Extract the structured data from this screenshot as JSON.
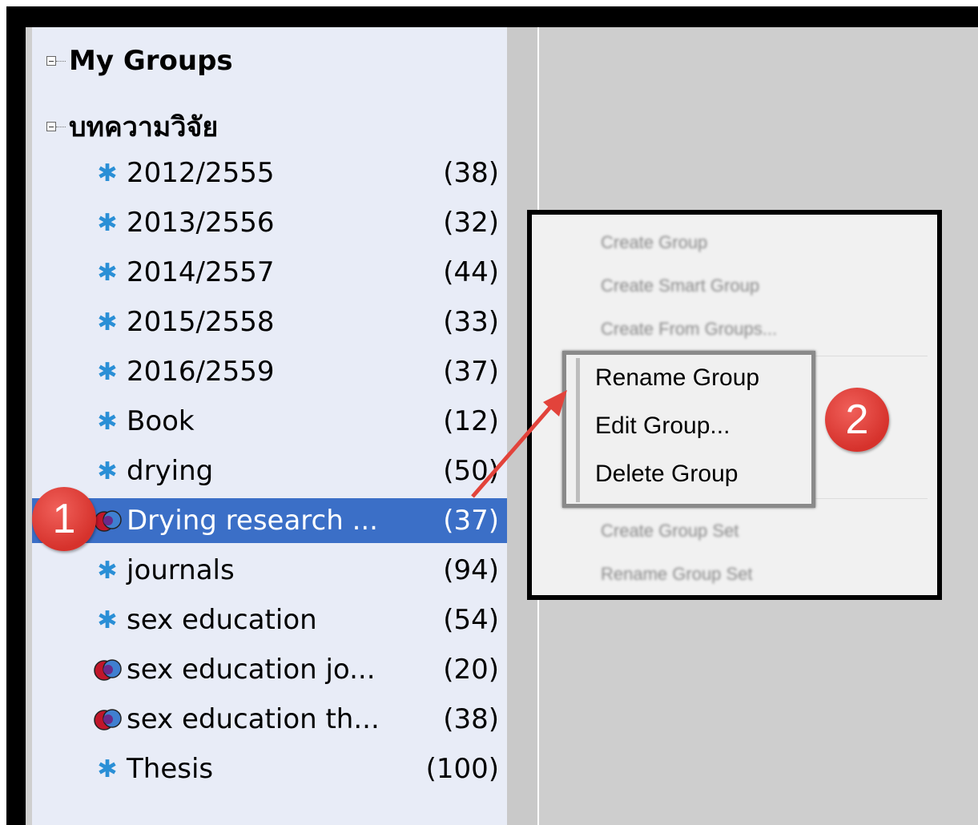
{
  "groups_header": "My Groups",
  "group_set_name": "บทความวิจัย",
  "groups": [
    {
      "label": "2012/2555",
      "count": "(38)",
      "kind": "group",
      "icon": "gear-icon"
    },
    {
      "label": "2013/2556",
      "count": "(32)",
      "kind": "group",
      "icon": "gear-icon"
    },
    {
      "label": "2014/2557",
      "count": "(44)",
      "kind": "group",
      "icon": "gear-icon"
    },
    {
      "label": "2015/2558",
      "count": "(33)",
      "kind": "group",
      "icon": "gear-icon"
    },
    {
      "label": "2016/2559",
      "count": "(37)",
      "kind": "group",
      "icon": "gear-icon"
    },
    {
      "label": "Book",
      "count": "(12)",
      "kind": "group",
      "icon": "gear-icon"
    },
    {
      "label": "drying",
      "count": "(50)",
      "kind": "group",
      "icon": "gear-icon"
    },
    {
      "label": "Drying research ...",
      "count": "(37)",
      "kind": "combined",
      "icon": "combined-group-icon",
      "selected": true
    },
    {
      "label": "journals",
      "count": "(94)",
      "kind": "group",
      "icon": "gear-icon"
    },
    {
      "label": "sex education",
      "count": "(54)",
      "kind": "group",
      "icon": "gear-icon"
    },
    {
      "label": "sex education jo...",
      "count": "(20)",
      "kind": "combined",
      "icon": "combined-group-icon"
    },
    {
      "label": "sex education th...",
      "count": "(38)",
      "kind": "combined",
      "icon": "combined-group-icon"
    },
    {
      "label": "Thesis",
      "count": "(100)",
      "kind": "group",
      "icon": "gear-icon"
    }
  ],
  "context_menu": {
    "blurred_top": [
      "Create Group",
      "Create Smart Group",
      "Create From Groups..."
    ],
    "highlighted": [
      "Rename Group",
      "Edit Group...",
      "Delete Group"
    ],
    "blurred_bottom": [
      "Create Group Set",
      "Rename Group Set"
    ]
  },
  "callouts": {
    "one": "1",
    "two": "2"
  },
  "colors": {
    "selection": "#3b6fc7",
    "badge": "#d6322c",
    "arrow": "#e2433b",
    "pane": "#e8ecf7"
  }
}
